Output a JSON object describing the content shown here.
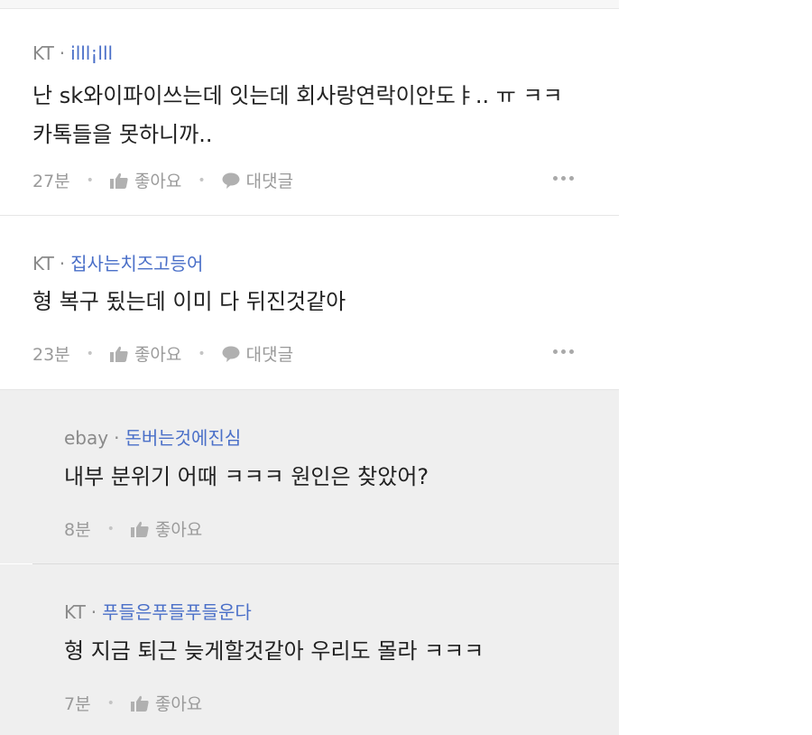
{
  "comments": [
    {
      "telecom": "KT",
      "author": "illl¡lll",
      "text_line1": "난 sk와이파이쓰는데 잇는데 회사랑연락이안도ㅑ.. ㅠ ㅋㅋ",
      "text_line2": "카톡들을 못하니까..",
      "time": "27분",
      "like_label": "좋아요",
      "reply_label": "대댓글"
    },
    {
      "telecom": "KT",
      "author": "집사는치즈고등어",
      "text_line1": "형 복구 됬는데 이미 다 뒤진것같아",
      "time": "23분",
      "like_label": "좋아요",
      "reply_label": "대댓글"
    }
  ],
  "replies": [
    {
      "telecom": "ebay",
      "author": "돈버는것에진심",
      "text": "내부 분위기 어때 ㅋㅋㅋ 원인은 찾았어?",
      "time": "8분",
      "like_label": "좋아요"
    },
    {
      "telecom": "KT",
      "author": "푸들은푸들푸들운다",
      "text": "형 지금 퇴근 늦게할것같아 우리도 몰라 ㅋㅋㅋ",
      "time": "7분",
      "like_label": "좋아요"
    }
  ],
  "colors": {
    "author": "#4a6fc8",
    "meta": "#8a8a8a",
    "reply_bg": "#efefef"
  },
  "icons": [
    "thumbs-up-icon",
    "speech-bubble-icon",
    "more-icon"
  ]
}
